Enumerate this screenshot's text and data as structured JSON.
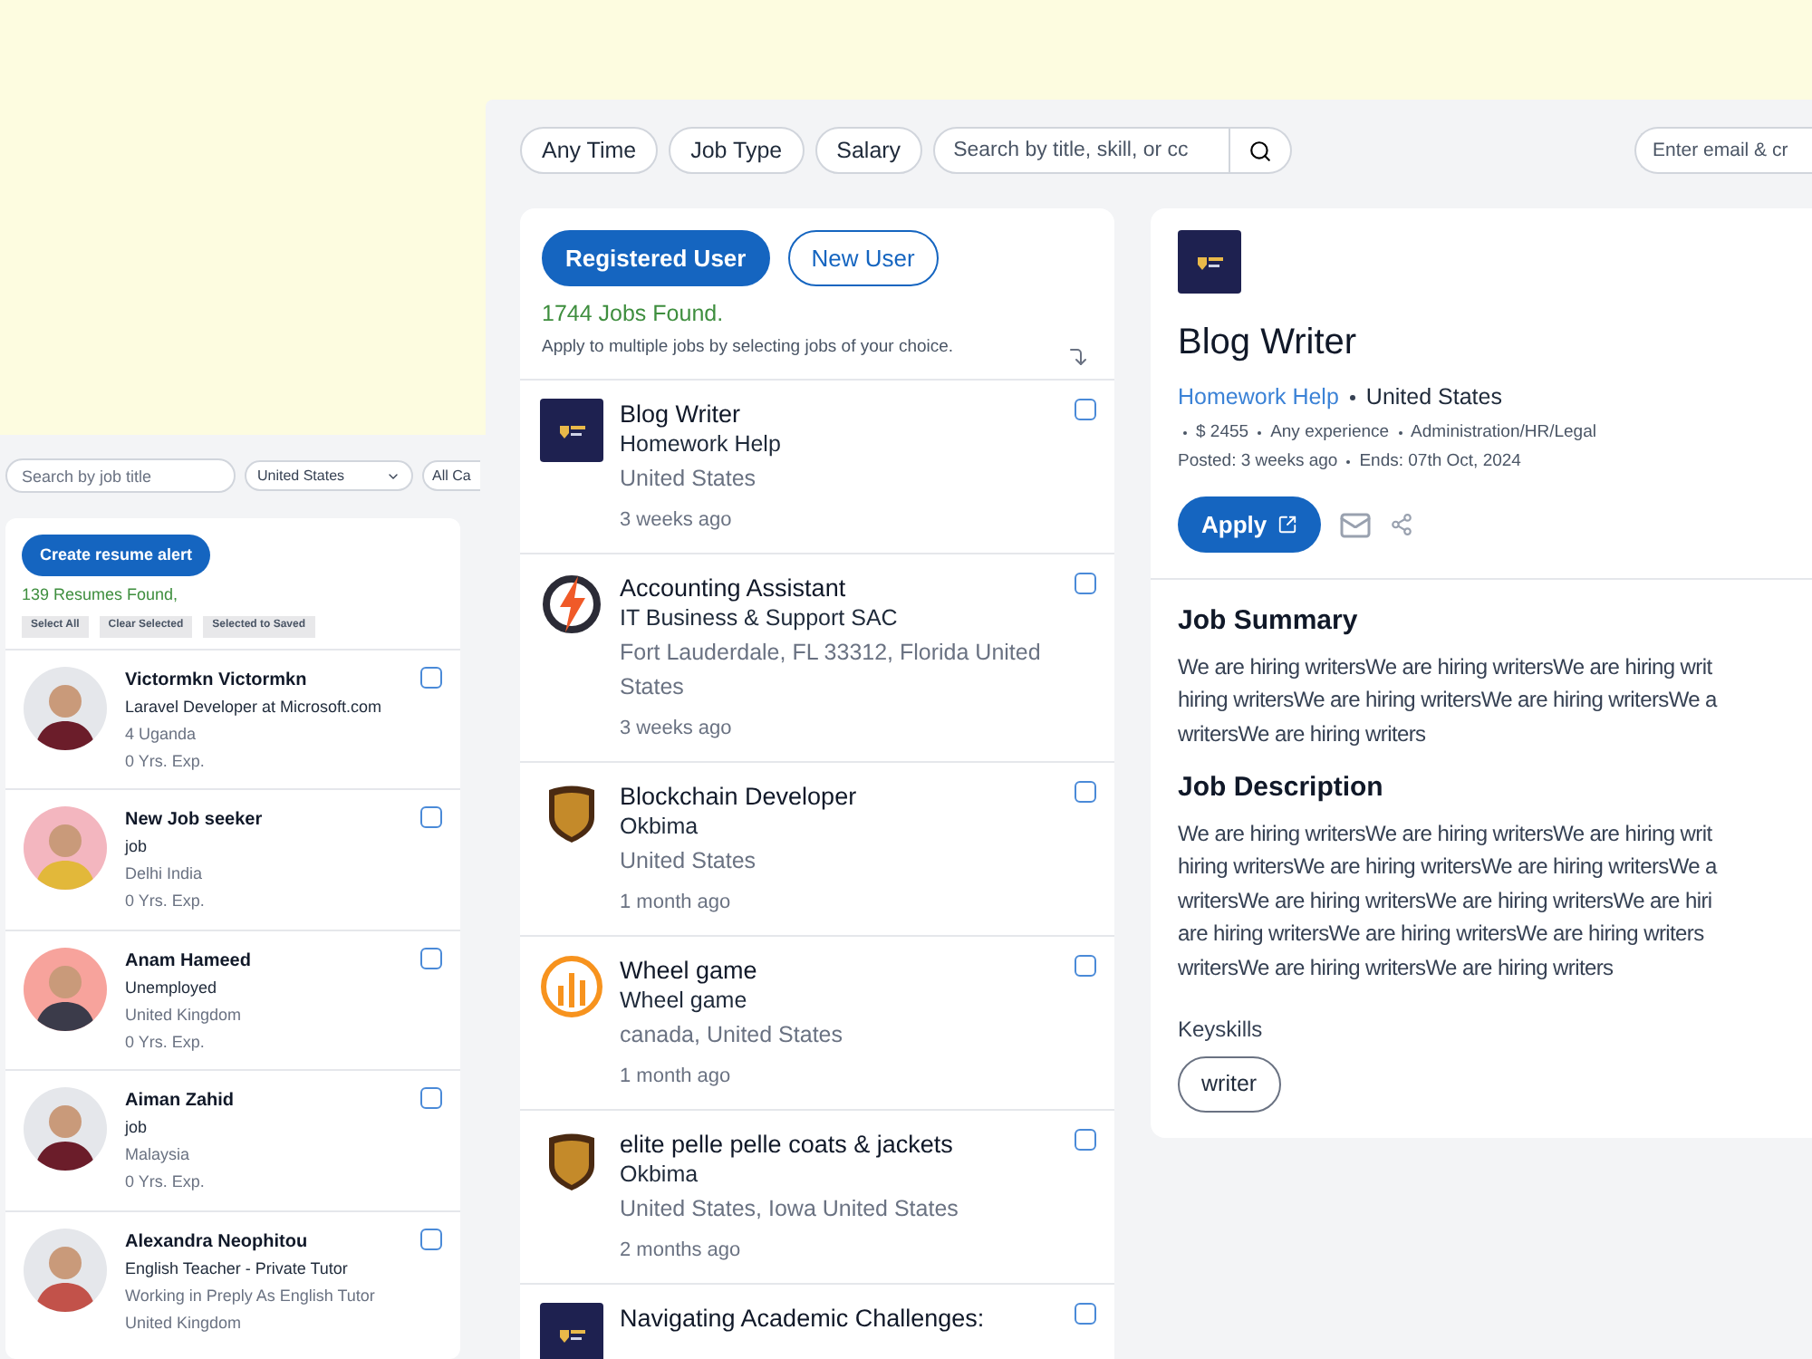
{
  "resume_window": {
    "search": {
      "placeholder": "Search by job title"
    },
    "country_select": {
      "value": "United States"
    },
    "category_select": {
      "value": "All Ca"
    },
    "create_alert_button": "Create resume alert",
    "count": "139 Resumes Found,",
    "actions": [
      "Select All",
      "Clear Selected",
      "Selected to Saved"
    ],
    "resumes": [
      {
        "name": "Victormkn Victormkn",
        "headline": "Laravel Developer at Microsoft.com",
        "lines": [
          "4 Uganda",
          "0 Yrs. Exp."
        ],
        "checked": false
      },
      {
        "name": "New Job seeker",
        "headline": "job",
        "lines": [
          "Delhi India",
          "0 Yrs. Exp."
        ],
        "checked": false
      },
      {
        "name": "Anam Hameed",
        "headline": "Unemployed",
        "lines": [
          "United Kingdom",
          "0 Yrs. Exp."
        ],
        "checked": false
      },
      {
        "name": "Aiman Zahid",
        "headline": "job",
        "lines": [
          "Malaysia",
          "0 Yrs. Exp."
        ],
        "checked": false
      },
      {
        "name": "Alexandra Neophitou",
        "headline": "English Teacher - Private Tutor",
        "lines": [
          "Working in Preply As English Tutor",
          "United Kingdom"
        ],
        "checked": false
      }
    ]
  },
  "jobs_window": {
    "filters": [
      "Any Time",
      "Job Type",
      "Salary"
    ],
    "search": {
      "placeholder": "Search by title, skill, or cc"
    },
    "email_field": {
      "placeholder": "Enter email & cr"
    },
    "user_tabs": [
      {
        "label": "Registered User",
        "selected": true
      },
      {
        "label": "New User",
        "selected": false
      }
    ],
    "count": "1744 Jobs Found.",
    "hint": "Apply to multiple jobs by selecting jobs of your choice.",
    "jobs": [
      {
        "title": "Blog Writer",
        "company": "Homework Help",
        "location": "United States",
        "posted": "3 weeks ago",
        "kind": "essay",
        "checked": false
      },
      {
        "title": "Accounting Assistant",
        "company": "IT Business & Support SAC",
        "location": "Fort Lauderdale, FL 33312, Florida United States",
        "posted": "3 weeks ago",
        "kind": "bolt",
        "checked": false
      },
      {
        "title": "Blockchain Developer",
        "company": "Okbima",
        "location": "United States",
        "posted": "1 month ago",
        "kind": "shield",
        "checked": false
      },
      {
        "title": "Wheel game",
        "company": "Wheel game",
        "location": "canada, United States",
        "posted": "1 month ago",
        "kind": "bars",
        "checked": false
      },
      {
        "title": "elite pelle pelle coats & jackets",
        "company": "Okbima",
        "location": "United States, Iowa United States",
        "posted": "2 months ago",
        "kind": "shield",
        "checked": false
      },
      {
        "title": "Navigating Academic Challenges:",
        "kind": "essay",
        "checked": false
      }
    ],
    "detail": {
      "title": "Blog Writer",
      "company": "Homework Help",
      "location": "United States",
      "meta": [
        "$ 2455",
        "Any experience",
        "Administration/HR/Legal"
      ],
      "posted": "Posted: 3 weeks ago",
      "ends": "Ends: 07th Oct, 2024",
      "apply_button": "Apply",
      "sections": [
        {
          "heading": "Job Summary",
          "lines": [
            "We are hiring writersWe are hiring writersWe are hiring writ",
            "hiring writersWe are hiring writersWe are hiring writersWe a",
            "writersWe are hiring writers"
          ]
        },
        {
          "heading": "Job Description",
          "lines": [
            "We are hiring writersWe are hiring writersWe are hiring writ",
            "hiring writersWe are hiring writersWe are hiring writersWe a",
            "writersWe are hiring writersWe are hiring writersWe are hiri",
            "are hiring writersWe are hiring writersWe are hiring writers",
            "writersWe are hiring writersWe are hiring writers"
          ]
        }
      ],
      "keyskills_label": "Keyskills",
      "skills": [
        "writer"
      ]
    }
  }
}
